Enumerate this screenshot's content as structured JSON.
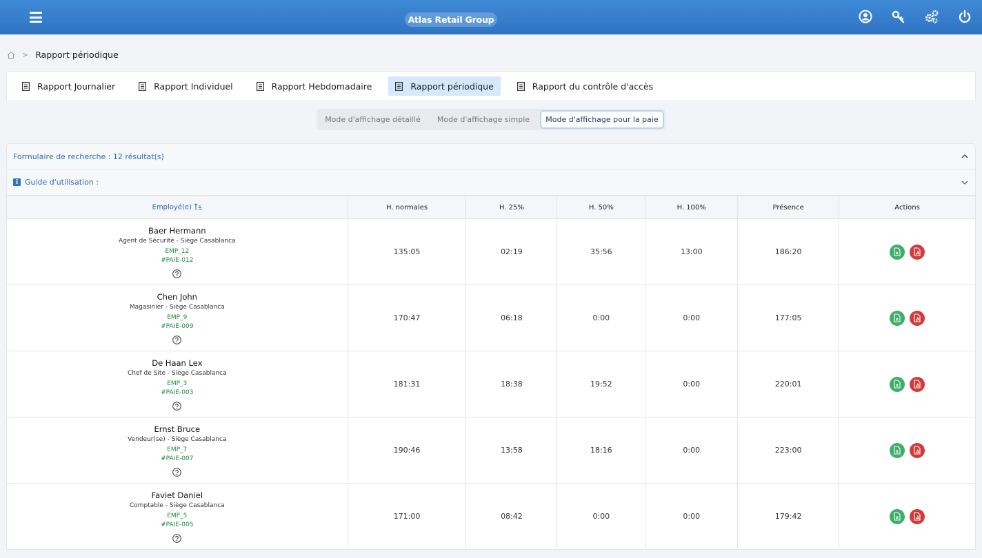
{
  "header": {
    "brand": "Atlas Retail Group"
  },
  "breadcrumb": {
    "current": "Rapport périodique"
  },
  "tabs": [
    {
      "label": "Rapport Journalier"
    },
    {
      "label": "Rapport Individuel"
    },
    {
      "label": "Rapport Hebdomadaire"
    },
    {
      "label": "Rapport périodique"
    },
    {
      "label": "Rapport du contrôle d'accès"
    }
  ],
  "modes": [
    {
      "label": "Mode d'affichage détaillé"
    },
    {
      "label": "Mode d'affichage simple"
    },
    {
      "label": "Mode d'affichage pour la paie"
    }
  ],
  "search_panel": {
    "title": "Formulaire de recherche : 12 résultat(s)"
  },
  "guide_panel": {
    "title": "Guide d'utilisation :"
  },
  "table": {
    "headers": [
      "Employé(e)",
      "H. normales",
      "H. 25%",
      "H. 50%",
      "H. 100%",
      "Présence",
      "Actions"
    ],
    "rows": [
      {
        "name": "Baer Hermann",
        "position": "Agent de Sécurité - Siège Casablanca",
        "emp": "EMP_12",
        "paie": "#PAIE-012",
        "normales": "135:05",
        "h25": "02:19",
        "h50": "35:56",
        "h100": "13:00",
        "presence": "186:20"
      },
      {
        "name": "Chen John",
        "position": "Magasinier - Siège Casablanca",
        "emp": "EMP_9",
        "paie": "#PAIE-009",
        "normales": "170:47",
        "h25": "06:18",
        "h50": "0:00",
        "h100": "0:00",
        "presence": "177:05"
      },
      {
        "name": "De Haan Lex",
        "position": "Chef de Site - Siège Casablanca",
        "emp": "EMP_3",
        "paie": "#PAIE-003",
        "normales": "181:31",
        "h25": "18:38",
        "h50": "19:52",
        "h100": "0:00",
        "presence": "220:01"
      },
      {
        "name": "Ernst Bruce",
        "position": "Vendeur(se) - Siège Casablanca",
        "emp": "EMP_7",
        "paie": "#PAIE-007",
        "normales": "190:46",
        "h25": "13:58",
        "h50": "18:16",
        "h100": "0:00",
        "presence": "223:00"
      },
      {
        "name": "Faviet Daniel",
        "position": "Comptable - Siège Casablanca",
        "emp": "EMP_5",
        "paie": "#PAIE-005",
        "normales": "171:00",
        "h25": "08:42",
        "h50": "0:00",
        "h100": "0:00",
        "presence": "179:42"
      }
    ]
  },
  "icons": {
    "menu": "hamburger-icon",
    "user": "user-icon",
    "key": "key-icon",
    "settings": "gears-icon",
    "power": "power-icon",
    "excel": "excel-export-icon",
    "pdf": "pdf-export-icon",
    "help": "help-icon"
  },
  "colors": {
    "header": "#3582cf",
    "accent": "#2a6cb4",
    "excel": "#3fae6a",
    "pdf": "#d33a3a",
    "code": "#1e8a4a"
  }
}
